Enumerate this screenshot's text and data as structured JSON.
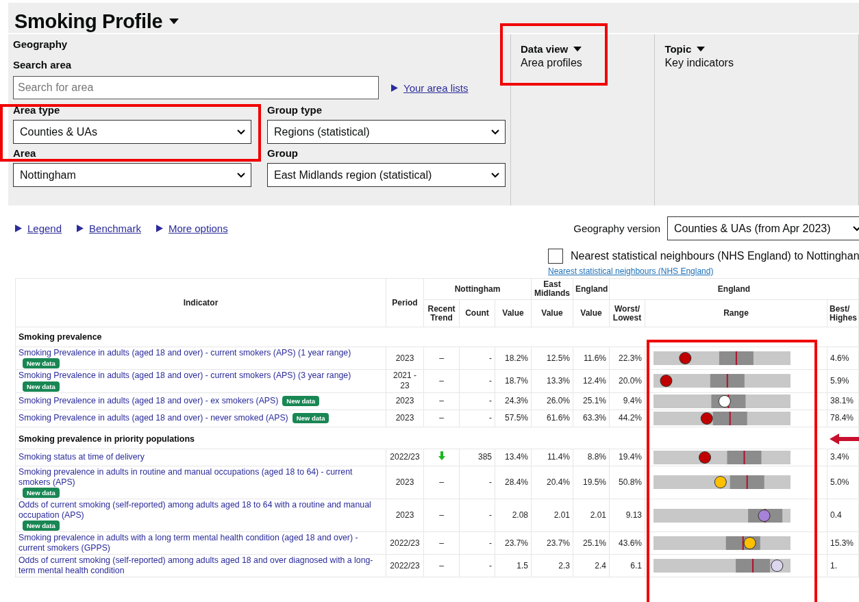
{
  "title": "Smoking Profile",
  "geography": {
    "heading": "Geography",
    "search_label": "Search area",
    "search_placeholder": "Search for area",
    "area_lists_link": "Your area lists",
    "selects": [
      {
        "label": "Area type",
        "value": "Counties & UAs"
      },
      {
        "label": "Group type",
        "value": "Regions (statistical)"
      },
      {
        "label": "Area",
        "value": "Nottingham"
      },
      {
        "label": "Group",
        "value": "East Midlands region (statistical)"
      }
    ]
  },
  "data_view": {
    "label": "Data view",
    "value": "Area profiles"
  },
  "topic": {
    "label": "Topic",
    "value": "Key indicators"
  },
  "options_links": [
    "Legend",
    "Benchmark",
    "More options"
  ],
  "geography_version": {
    "label": "Geography version",
    "value": "Counties & UAs (from Apr 2023)"
  },
  "neighbours": {
    "label": "Nearest statistical neighbours (NHS England) to Nottinghan",
    "checked": false,
    "link": "Nearest statistical neighbours (NHS England)"
  },
  "headers": {
    "indicator": "Indicator",
    "period": "Period",
    "area": "Nottingham",
    "trend": "Recent Trend",
    "count": "Count",
    "value": "Value",
    "region": "East Midlands",
    "region_value": "Value",
    "england": "England",
    "england_value": "Value",
    "england_range": "England",
    "worst": "Worst/ Lowest",
    "range": "Range",
    "best": "Best/ Highes"
  },
  "sections": [
    {
      "title": "Smoking prevalence",
      "rows": [
        {
          "indicator": "Smoking Prevalence in adults (aged 18 and over) - current smokers (APS) (1 year range)",
          "badge": "New data",
          "period": "2023",
          "trend": {
            "kind": "none",
            "text": "–"
          },
          "count": "-",
          "value": "18.2%",
          "region": "12.5%",
          "england": "11.6%",
          "worst": "22.3%",
          "best": "4.6%",
          "color": "#c00000"
        },
        {
          "indicator": "Smoking Prevalence in adults (aged 18 and over) - current smokers (APS) (3 year range)",
          "badge": "New data",
          "period": "2021 - 23",
          "trend": {
            "kind": "none",
            "text": "–"
          },
          "count": "-",
          "value": "18.7%",
          "region": "13.3%",
          "england": "12.4%",
          "worst": "20.0%",
          "best": "5.9%",
          "color": "#c00000"
        },
        {
          "indicator": "Smoking Prevalence in adults (aged 18 and over) - ex smokers (APS)",
          "badge": "New data",
          "period": "2023",
          "trend": {
            "kind": "none",
            "text": "–"
          },
          "count": "-",
          "value": "24.3%",
          "region": "26.0%",
          "england": "25.1%",
          "worst": "9.4%",
          "best": "38.1%",
          "color": "#ffffff"
        },
        {
          "indicator": "Smoking Prevalence in adults (aged 18 and over) - never smoked (APS)",
          "badge": "New data",
          "period": "2023",
          "trend": {
            "kind": "none",
            "text": "–"
          },
          "count": "-",
          "value": "57.5%",
          "region": "61.6%",
          "england": "63.3%",
          "worst": "44.2%",
          "best": "78.4%",
          "color": "#c00000"
        }
      ]
    },
    {
      "title": "Smoking prevalence in priority populations",
      "rows": [
        {
          "indicator": "Smoking status at time of delivery",
          "period": "2022/23",
          "trend": {
            "kind": "down"
          },
          "count": "385",
          "value": "13.4%",
          "region": "11.4%",
          "england": "8.8%",
          "worst": "19.4%",
          "best": "3.4%",
          "color": "#c00000"
        },
        {
          "indicator": "Smoking prevalence in adults in routine and manual occupations (aged 18 to 64) - current smokers (APS)",
          "badge": "New data",
          "period": "2023",
          "trend": {
            "kind": "none",
            "text": "–"
          },
          "count": "-",
          "value": "28.4%",
          "region": "20.4%",
          "england": "19.5%",
          "worst": "50.8%",
          "best": "5.0%",
          "color": "#ffc000"
        },
        {
          "indicator": "Odds of current smoking (self-reported) among adults aged 18 to 64 with a routine and manual occupation (APS)",
          "badge": "New data",
          "period": "2023",
          "trend": {
            "kind": "none",
            "text": "–"
          },
          "count": "-",
          "value": "2.08",
          "region": "2.01",
          "england": "2.01",
          "worst": "9.13",
          "best": "0.4",
          "color": "#a682d8"
        },
        {
          "indicator": "Smoking prevalence in adults with a long term mental health condition (aged 18 and over) - current smokers (GPPS)",
          "period": "2022/23",
          "trend": {
            "kind": "none",
            "text": "–"
          },
          "count": "-",
          "value": "23.7%",
          "region": "23.7%",
          "england": "25.1%",
          "worst": "43.6%",
          "best": "15.3%",
          "color": "#ffc000"
        },
        {
          "indicator": "Odds of current smoking (self-reported) among adults aged 18 and over diagnosed with a long-term mental health condition",
          "period": "2022/23",
          "trend": {
            "kind": "none",
            "text": "–"
          },
          "count": "-",
          "value": "1.5",
          "region": "2.3",
          "england": "2.4",
          "worst": "6.1",
          "best": "1.",
          "color": "#dcd6ee"
        }
      ]
    }
  ]
}
